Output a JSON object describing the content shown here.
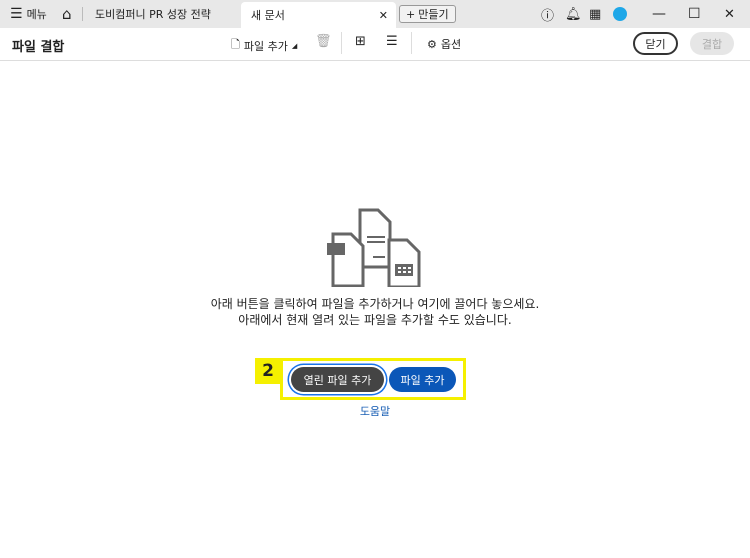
{
  "tabbar": {
    "menu": "메뉴",
    "tab1": "도비컴퍼니 PR 성장 전략",
    "tab2": "새 문서",
    "new": "만들기"
  },
  "toolbar": {
    "title": "파일 결합",
    "add_files": "파일 추가",
    "options": "옵션",
    "close": "닫기",
    "combine": "결합"
  },
  "main": {
    "line1": "아래 버튼을 클릭하여 파일을 추가하거나 여기에 끌어다 놓으세요.",
    "line2": "아래에서 현재 열려 있는 파일을 추가할 수도 있습니다.",
    "open_files": "열린 파일 추가",
    "add_files": "파일 추가",
    "help": "도움말",
    "badge": "2"
  }
}
